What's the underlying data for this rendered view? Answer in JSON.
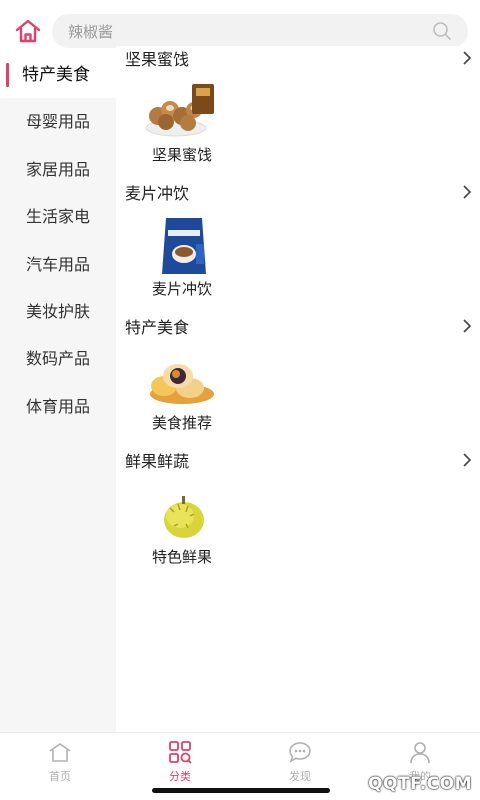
{
  "search": {
    "placeholder": "辣椒酱"
  },
  "sidebar": {
    "items": [
      {
        "label": "特产美食",
        "active": true
      },
      {
        "label": "母婴用品"
      },
      {
        "label": "家居用品"
      },
      {
        "label": "生活家电"
      },
      {
        "label": "汽车用品"
      },
      {
        "label": "美妆护肤"
      },
      {
        "label": "数码产品"
      },
      {
        "label": "体育用品"
      }
    ]
  },
  "sections": [
    {
      "title": "坚果蜜饯",
      "item": {
        "label": "坚果蜜饯",
        "icon": "nuts-image"
      }
    },
    {
      "title": "麦片冲饮",
      "item": {
        "label": "麦片冲饮",
        "icon": "coffee-pack-image"
      }
    },
    {
      "title": "特产美食",
      "item": {
        "label": "美食推荐",
        "icon": "pastry-image"
      }
    },
    {
      "title": "鲜果鲜蔬",
      "item": {
        "label": "特色鲜果",
        "icon": "durian-image"
      }
    }
  ],
  "tabbar": {
    "tabs": [
      {
        "label": "首页",
        "icon": "home-icon"
      },
      {
        "label": "分类",
        "icon": "category-icon",
        "active": true
      },
      {
        "label": "发现",
        "icon": "chat-bubble-icon"
      },
      {
        "label": "我的",
        "icon": "user-icon"
      }
    ]
  },
  "watermark": "QQTF.COM",
  "colors": {
    "accent": "#e0406a",
    "sidebar_bg": "#f6f6f6",
    "search_bg": "#f2f2f2"
  }
}
